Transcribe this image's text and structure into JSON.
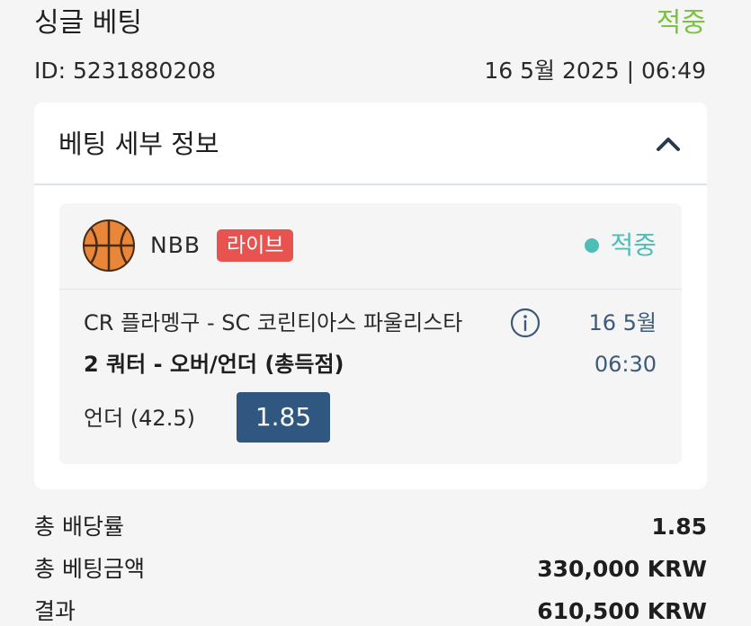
{
  "header": {
    "bet_type": "싱글 베팅",
    "status": "적중",
    "bet_id": "ID: 5231880208",
    "date_time": "16 5월 2025 | 06:49"
  },
  "details": {
    "title": "베팅 세부 정보",
    "toggle_icon": "chevron-up-icon"
  },
  "selection": {
    "sport_icon": "basketball-icon",
    "league": "NBB",
    "live_badge": "라이브",
    "status": "적중",
    "match": "CR 플라멩구 - SC 코린티아스 파울리스타",
    "info_icon": "info-icon",
    "date": "16 5월",
    "market": "2 쿼터 - 오버/언더 (총득점)",
    "time": "06:30",
    "pick": "언더 (42.5)",
    "odds": "1.85"
  },
  "summary": [
    {
      "label": "총 배당률",
      "value": "1.85"
    },
    {
      "label": "총 베팅금액",
      "value": "330,000 KRW"
    },
    {
      "label": "결과",
      "value": "610,500 KRW"
    }
  ],
  "colors": {
    "won_green": "#7cc244",
    "won_teal": "#4fbdb5",
    "live_red": "#e9534f",
    "odds_navy": "#2f5780"
  }
}
